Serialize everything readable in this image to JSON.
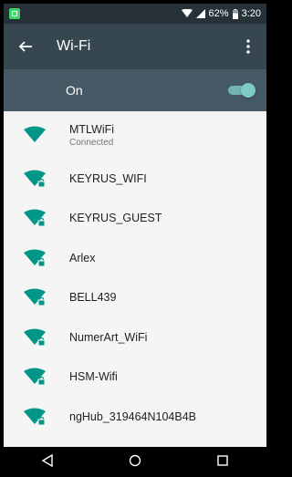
{
  "status_bar": {
    "battery": "62%",
    "time": "3:20",
    "icons": [
      "notification-icon",
      "wifi-signal-icon",
      "cell-signal-icon",
      "battery-icon"
    ]
  },
  "toolbar": {
    "title": "Wi-Fi",
    "back_icon": "arrow-left",
    "menu_icon": "more-vertical"
  },
  "master_switch": {
    "label": "On",
    "state": "on"
  },
  "colors": {
    "accent": "#009688",
    "toolbar": "#37474f",
    "master_bar": "#455a64",
    "status_bar": "#263238",
    "list_bg": "#f5f5f5"
  },
  "networks": [
    {
      "ssid": "MTLWiFi",
      "status": "Connected",
      "secured": false
    },
    {
      "ssid": "KEYRUS_WIFI",
      "secured": true
    },
    {
      "ssid": "KEYRUS_GUEST",
      "secured": true
    },
    {
      "ssid": "Arlex",
      "secured": true
    },
    {
      "ssid": "BELL439",
      "secured": true
    },
    {
      "ssid": "NumerArt_WiFi",
      "secured": true
    },
    {
      "ssid": "HSM-Wifi",
      "secured": true
    },
    {
      "ssid": "ngHub_319464N104B4B",
      "secured": true
    }
  ],
  "nav_bar": {
    "buttons": [
      "back-triangle",
      "home-circle",
      "recents-square"
    ]
  }
}
